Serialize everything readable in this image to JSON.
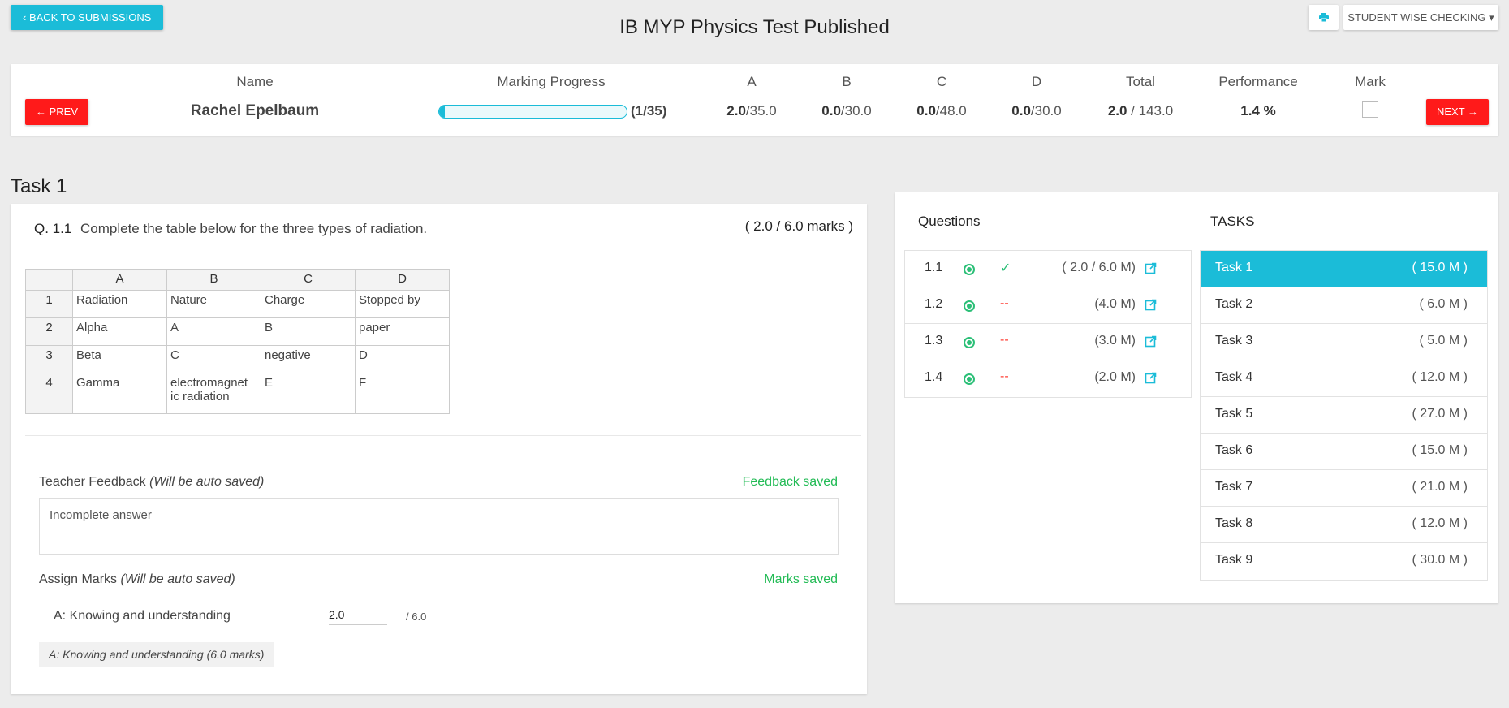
{
  "header": {
    "back_label": "‹ BACK TO SUBMISSIONS",
    "title": "IB MYP Physics Test Published",
    "print_icon": "print-icon",
    "mode_label": "STUDENT WISE CHECKING ▾"
  },
  "summary": {
    "prev_label": "← PREV",
    "next_label": "NEXT →",
    "headers": {
      "name": "Name",
      "progress": "Marking Progress",
      "a": "A",
      "b": "B",
      "c": "C",
      "d": "D",
      "total": "Total",
      "performance": "Performance",
      "mark": "Mark"
    },
    "student_name": "Rachel Epelbaum",
    "progress_fraction": 0.0286,
    "progress_count": "(1/35)",
    "a_score": "2.0",
    "a_max": "/35.0",
    "b_score": "0.0",
    "b_max": "/30.0",
    "c_score": "0.0",
    "c_max": "/48.0",
    "d_score": "0.0",
    "d_max": "/30.0",
    "total_score": "2.0",
    "total_max": " / 143.0",
    "performance": "1.4 %",
    "mark_checked": false
  },
  "task_heading": "Task 1",
  "question": {
    "number": "Q. 1.1",
    "text": "Complete the table below for the three types of radiation.",
    "marks": "( 2.0 / 6.0 marks )",
    "table": {
      "col_headers": [
        "A",
        "B",
        "C",
        "D"
      ],
      "rows": [
        {
          "row": "1",
          "cells": [
            "Radiation",
            "Nature",
            "Charge",
            "Stopped by"
          ]
        },
        {
          "row": "2",
          "cells": [
            "Alpha",
            "A",
            "B",
            "paper"
          ]
        },
        {
          "row": "3",
          "cells": [
            "Beta",
            "C",
            "negative",
            "D"
          ]
        },
        {
          "row": "4",
          "cells": [
            "Gamma",
            "electromagnet ic radiation",
            "E",
            "F"
          ]
        }
      ]
    },
    "feedback_label": "Teacher Feedback ",
    "feedback_hint": "(Will be auto saved)",
    "feedback_status": "Feedback saved",
    "feedback_text": "Incomplete answer",
    "marks_label": "Assign Marks ",
    "marks_hint": "(Will be auto saved)",
    "marks_status": "Marks saved",
    "criterion": "A: Knowing and understanding",
    "criterion_value": "2.0",
    "criterion_max": "/ 6.0",
    "criterion_tag": "A: Knowing and understanding (6.0 marks)"
  },
  "sidebar": {
    "questions_title": "Questions",
    "tasks_title": "TASKS",
    "questions": [
      {
        "num": "1.1",
        "status": "✓",
        "marks": "( 2.0 /  6.0 M)"
      },
      {
        "num": "1.2",
        "status": "--",
        "marks": "(4.0 M)"
      },
      {
        "num": "1.3",
        "status": "--",
        "marks": "(3.0 M)"
      },
      {
        "num": "1.4",
        "status": "--",
        "marks": "(2.0 M)"
      }
    ],
    "tasks": [
      {
        "name": "Task 1",
        "marks": "( 15.0 M )"
      },
      {
        "name": "Task 2",
        "marks": "( 6.0 M )"
      },
      {
        "name": "Task 3",
        "marks": "( 5.0 M )"
      },
      {
        "name": "Task 4",
        "marks": "( 12.0 M )"
      },
      {
        "name": "Task 5",
        "marks": "( 27.0 M )"
      },
      {
        "name": "Task 6",
        "marks": "( 15.0 M )"
      },
      {
        "name": "Task 7",
        "marks": "( 21.0 M )"
      },
      {
        "name": "Task 8",
        "marks": "( 12.0 M )"
      },
      {
        "name": "Task 9",
        "marks": "( 30.0 M )"
      }
    ],
    "active_task": 0
  },
  "colors": {
    "accent": "#1bbcd8",
    "danger": "#ff1a1a",
    "success": "#22bb55"
  }
}
